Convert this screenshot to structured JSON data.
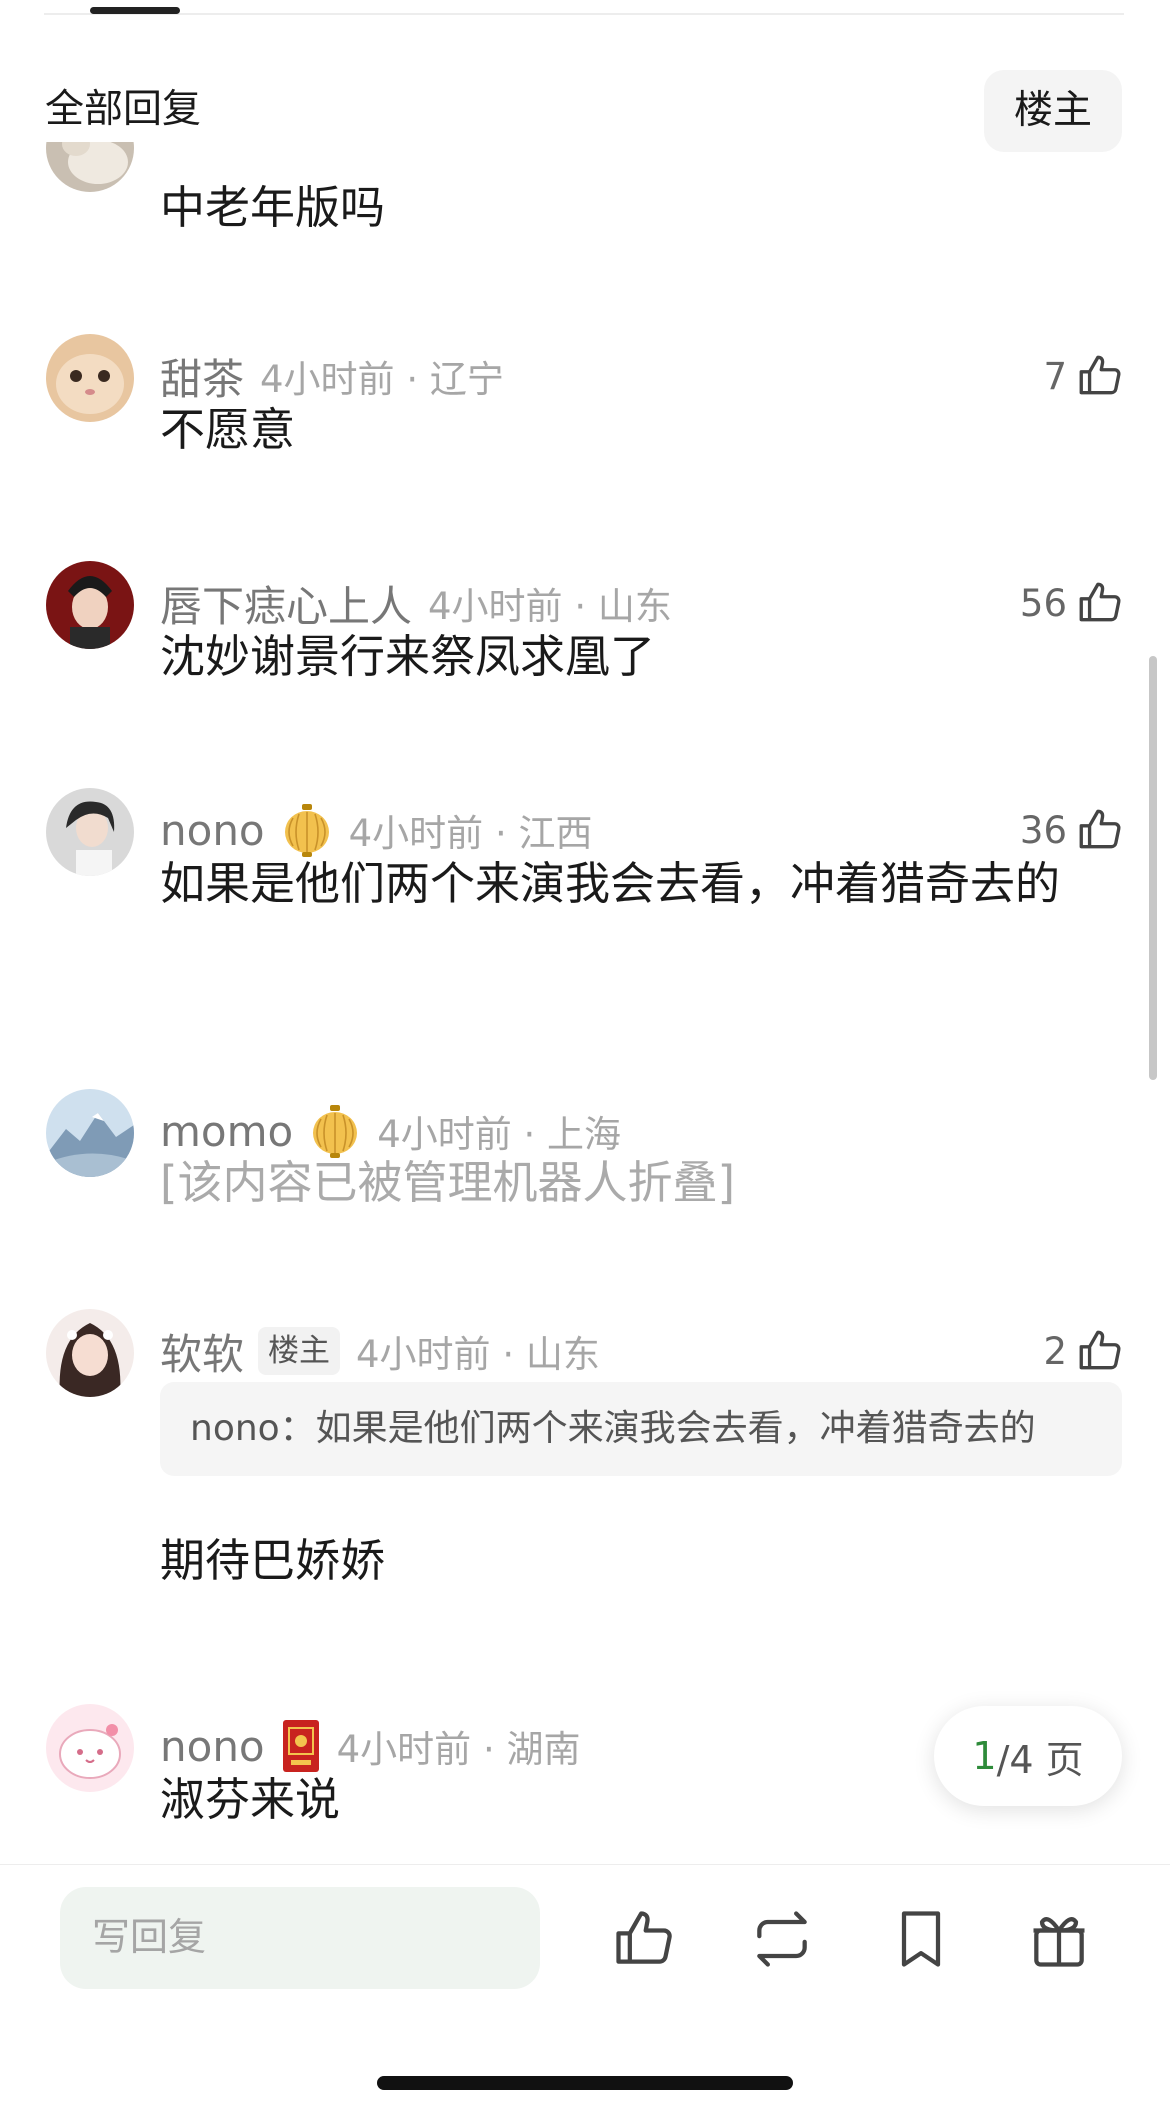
{
  "header": {
    "title": "全部回复",
    "owner_filter": "楼主"
  },
  "comments": [
    {
      "name": "",
      "time": "",
      "likes": "",
      "body": "中老年版吗"
    },
    {
      "name": "甜茶",
      "time": "4小时前 · 辽宁",
      "likes": "7",
      "body": "不愿意"
    },
    {
      "name": "唇下痣心上人",
      "time": "4小时前 · 山东",
      "likes": "56",
      "body": "沈妙谢景行来祭凤求凰了"
    },
    {
      "name": "nono",
      "badge": "lantern",
      "time": "4小时前 · 江西",
      "likes": "36",
      "body": "如果是他们两个来演我会去看，冲着猎奇去的"
    },
    {
      "name": "momo",
      "badge": "lantern",
      "time": "4小时前 · 上海",
      "likes": "",
      "body": "[该内容已被管理机器人折叠]"
    },
    {
      "name": "软软",
      "owner_badge": "楼主",
      "time": "4小时前 · 山东",
      "likes": "2",
      "quote": "nono：如果是他们两个来演我会去看，冲着猎奇去的",
      "body": "期待巴娇娇"
    },
    {
      "name": "nono",
      "badge": "envelope",
      "time": "4小时前 · 湖南",
      "likes": "",
      "body": "淑芬来说"
    }
  ],
  "pagination": {
    "current": "1",
    "total_text": "/4 页"
  },
  "bottom_bar": {
    "reply_placeholder": "写回复",
    "actions": [
      "thumbs-up-icon",
      "repost-icon",
      "bookmark-icon",
      "gift-icon"
    ]
  },
  "colors": {
    "accent_green": "#2e8b3a",
    "muted_text": "#a6a6a6",
    "folded_text": "#aaaaaa",
    "input_bg": "#eff4f0"
  }
}
